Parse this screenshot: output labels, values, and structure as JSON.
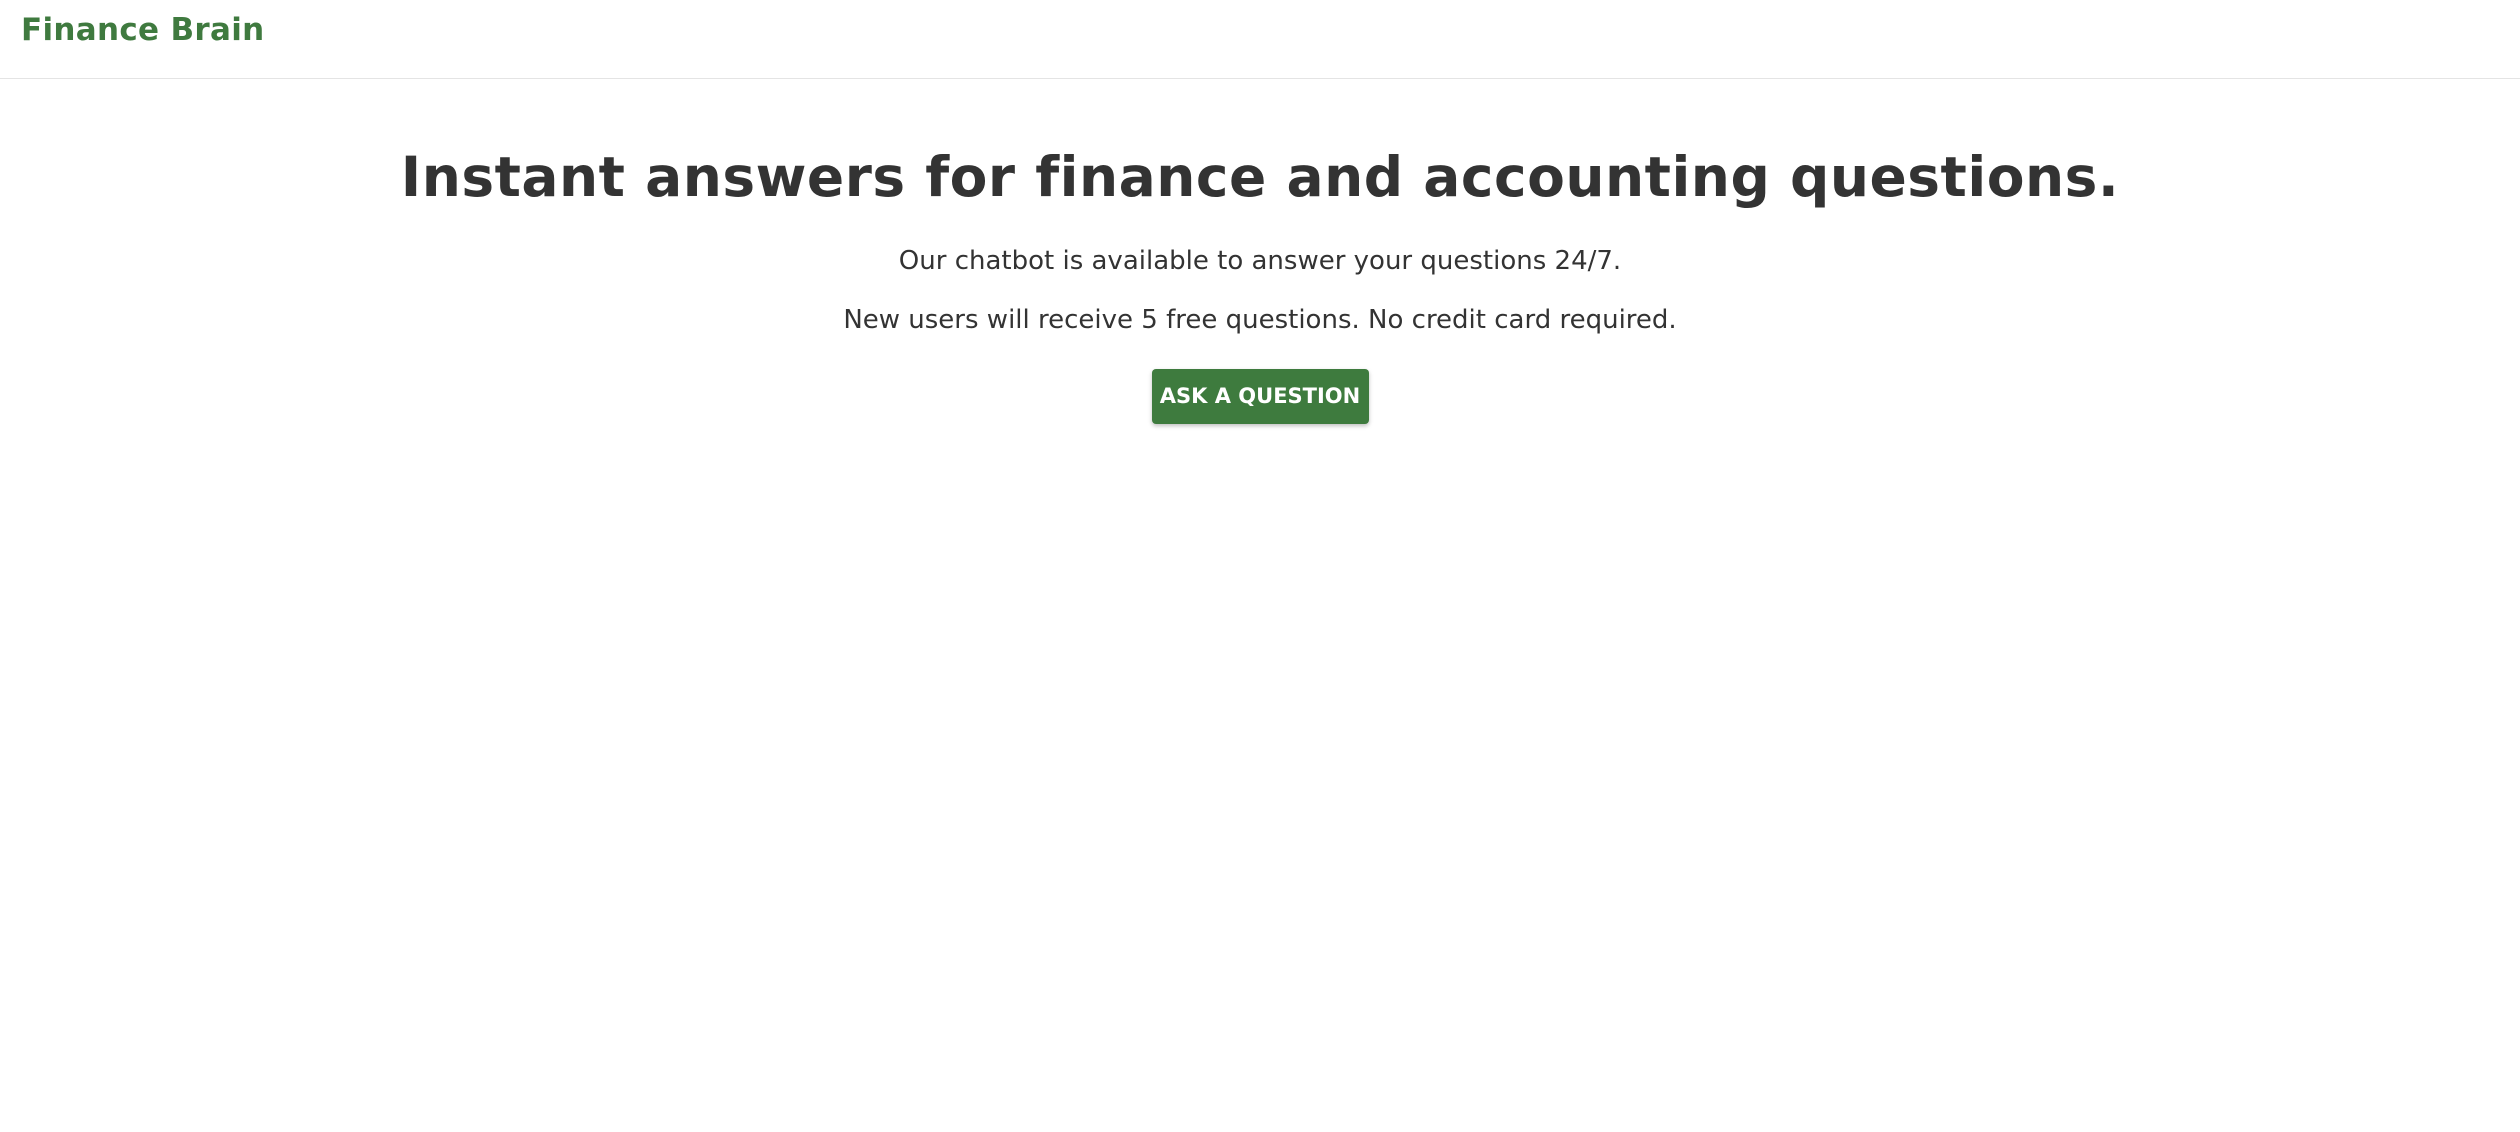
{
  "header": {
    "brand": "Finance Brain"
  },
  "hero": {
    "headline": "Instant answers for finance and accounting questions.",
    "line1": "Our chatbot is available to answer your questions 24/7.",
    "line2": "New users will receive 5 free questions. No credit card required.",
    "cta_label": "ASK A QUESTION"
  },
  "colors": {
    "brand": "#3f7a3f",
    "button": "#3e7b3e",
    "text": "#333333",
    "background": "#ffffff"
  }
}
